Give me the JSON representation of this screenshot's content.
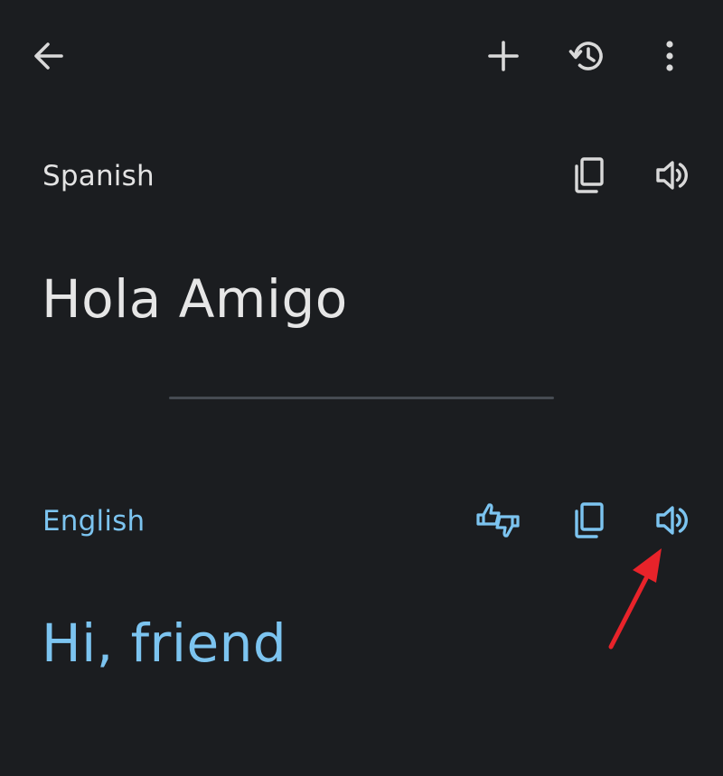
{
  "toolbar": {
    "back_icon": "arrow-left-icon",
    "add_icon": "plus-icon",
    "history_icon": "history-icon",
    "more_icon": "more-vertical-icon"
  },
  "source": {
    "language": "Spanish",
    "text": "Hola Amigo",
    "copy_icon": "copy-icon",
    "speak_icon": "speaker-icon"
  },
  "target": {
    "language": "English",
    "text": "Hi, friend",
    "feedback_icon": "feedback-icon",
    "copy_icon": "copy-icon",
    "speak_icon": "speaker-icon"
  },
  "colors": {
    "background": "#1b1d20",
    "source_text": "#e6e6e6",
    "target_accent": "#7cc4f0",
    "divider": "#464b52",
    "annotation": "#e8232a"
  }
}
